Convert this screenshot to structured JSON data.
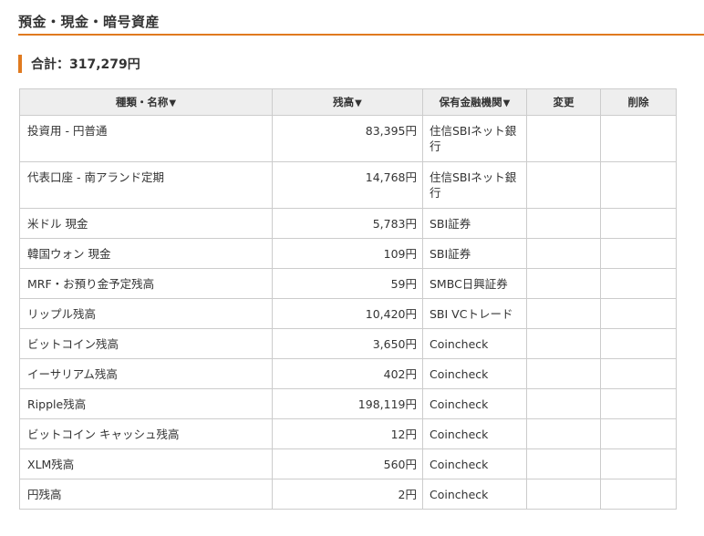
{
  "section": {
    "title": "預金・現金・暗号資産"
  },
  "total": {
    "label": "合計：317,279円"
  },
  "table": {
    "headers": {
      "name": "種類・名称",
      "balance": "残高",
      "institution": "保有金融機関",
      "edit": "変更",
      "delete": "削除",
      "sort_arrow": "▼"
    },
    "rows": [
      {
        "name": "投資用 - 円普通",
        "balance": "83,395円",
        "institution": "住信SBIネット銀行"
      },
      {
        "name": "代表口座 - 南アランド定期",
        "balance": "14,768円",
        "institution": "住信SBIネット銀行"
      },
      {
        "name": "米ドル 現金",
        "balance": "5,783円",
        "institution": "SBI証券"
      },
      {
        "name": "韓国ウォン 現金",
        "balance": "109円",
        "institution": "SBI証券"
      },
      {
        "name": "MRF・お預り金予定残高",
        "balance": "59円",
        "institution": "SMBC日興証券"
      },
      {
        "name": "リップル残高",
        "balance": "10,420円",
        "institution": "SBI VCトレード"
      },
      {
        "name": "ビットコイン残高",
        "balance": "3,650円",
        "institution": "Coincheck"
      },
      {
        "name": "イーサリアム残高",
        "balance": "402円",
        "institution": "Coincheck"
      },
      {
        "name": "Ripple残高",
        "balance": "198,119円",
        "institution": "Coincheck"
      },
      {
        "name": "ビットコイン キャッシュ残高",
        "balance": "12円",
        "institution": "Coincheck"
      },
      {
        "name": "XLM残高",
        "balance": "560円",
        "institution": "Coincheck"
      },
      {
        "name": "円残高",
        "balance": "2円",
        "institution": "Coincheck"
      }
    ]
  }
}
